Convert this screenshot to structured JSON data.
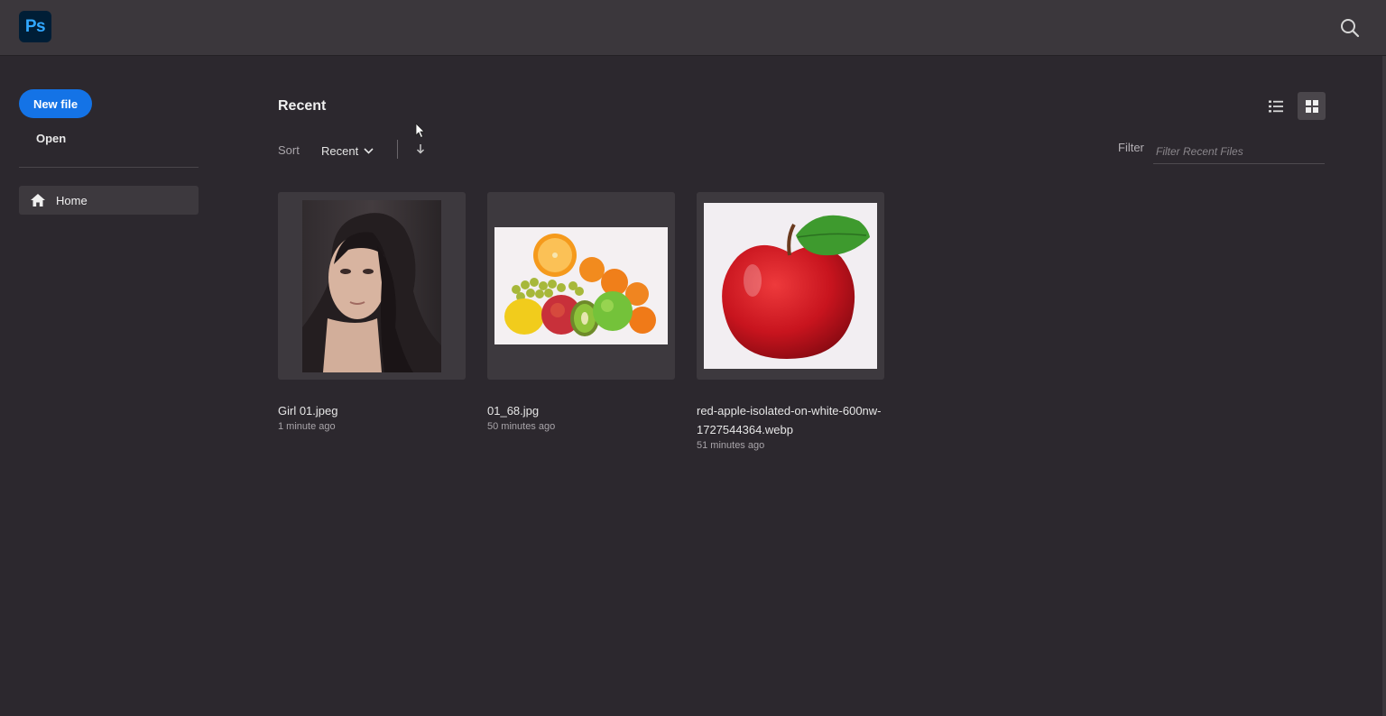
{
  "app": {
    "logo_text": "Ps"
  },
  "sidebar": {
    "new_file_label": "New file",
    "open_label": "Open",
    "items": [
      {
        "label": "Home",
        "icon": "home-icon",
        "active": true
      }
    ]
  },
  "main": {
    "section_title": "Recent",
    "sort": {
      "label": "Sort",
      "value": "Recent",
      "direction_icon": "arrow-down-icon"
    },
    "view_modes": [
      {
        "name": "list",
        "icon": "list-view-icon",
        "active": false
      },
      {
        "name": "grid",
        "icon": "grid-view-icon",
        "active": true
      }
    ],
    "filter": {
      "label": "Filter",
      "placeholder": "Filter Recent Files",
      "value": ""
    },
    "files": [
      {
        "name": "Girl 01.jpeg",
        "time": "1 minute ago",
        "thumbnail": "portrait-photo"
      },
      {
        "name": "01_68.jpg",
        "time": "50 minutes ago",
        "thumbnail": "fruit-pile-photo"
      },
      {
        "name": "red-apple-isolated-on-white-600nw-1727544364.webp",
        "time": "51 minutes ago",
        "thumbnail": "red-apple-photo"
      }
    ]
  },
  "colors": {
    "background": "#2c282e",
    "topbar": "#3b373c",
    "accent": "#1473e6",
    "ps_logo_bg": "#001e36",
    "ps_logo_text": "#31a8ff"
  }
}
